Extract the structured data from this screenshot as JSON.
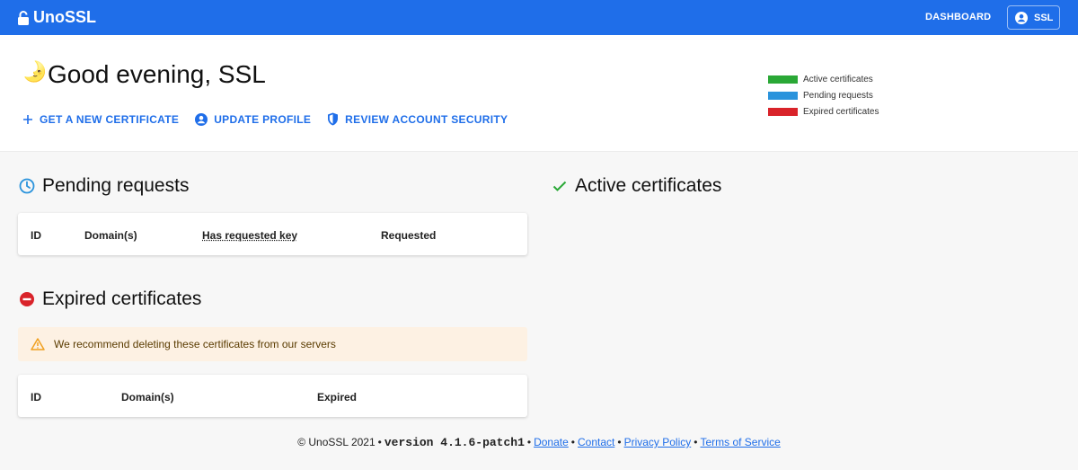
{
  "topbar": {
    "brand": "UnoSSL",
    "nav_dashboard": "DASHBOARD",
    "user_label": "SSL",
    "color": "#1f6ee9"
  },
  "header": {
    "greeting": "Good evening, SSL",
    "moon_icon": "🌛",
    "actions": [
      {
        "label": "GET A NEW CERTIFICATE",
        "icon": "plus-icon"
      },
      {
        "label": "UPDATE PROFILE",
        "icon": "user-circle-icon"
      },
      {
        "label": "REVIEW ACCOUNT SECURITY",
        "icon": "shield-icon"
      }
    ]
  },
  "legend": [
    {
      "label": "Active certificates",
      "color": "#2aa836"
    },
    {
      "label": "Pending requests",
      "color": "#2a93dc"
    },
    {
      "label": "Expired certificates",
      "color": "#d9232a"
    }
  ],
  "pending": {
    "title": "Pending requests",
    "columns": [
      "ID",
      "Domain(s)",
      "Has requested key",
      "Requested"
    ]
  },
  "active": {
    "title": "Active certificates"
  },
  "expired": {
    "title": "Expired certificates",
    "warning": "We recommend deleting these certificates from our servers",
    "columns": [
      "ID",
      "Domain(s)",
      "Expired"
    ]
  },
  "footer": {
    "copyright": "© UnoSSL 2021",
    "version": "version 4.1.6-patch1",
    "links": [
      "Donate",
      "Contact",
      "Privacy Policy",
      "Terms of Service"
    ]
  }
}
